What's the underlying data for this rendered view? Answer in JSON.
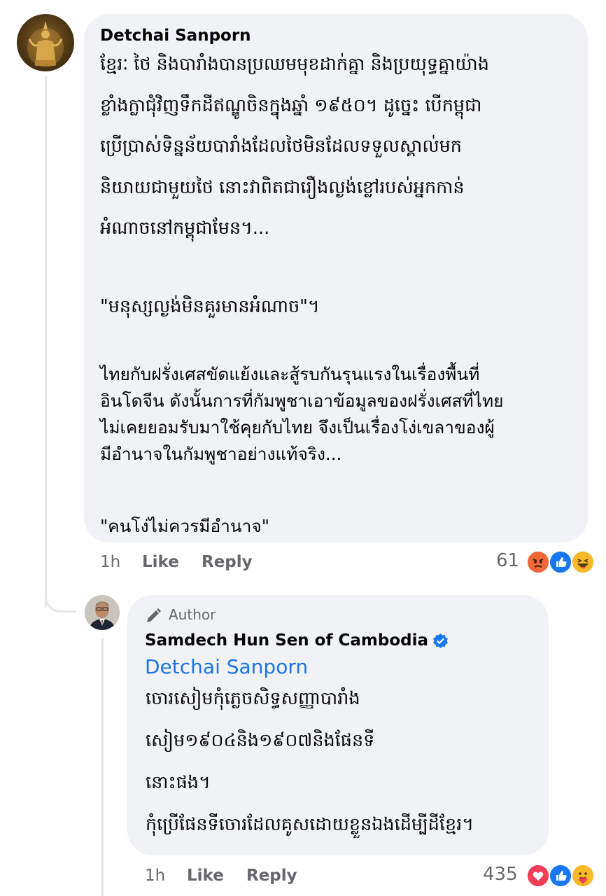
{
  "comment": {
    "author": "Detchai Sanporn",
    "khmer_lines": [
      "ខ្មែរៈ ថៃ និងបារាំងបានប្រឈមមុខដាក់គ្នា និងប្រយុទ្ធគ្នាយ៉ាង",
      "ខ្លាំងក្លាជុំវិញទឹកដីឥណ្ឌូចិនក្នុងឆ្នាំ ១៩៥០។ ដូច្នេះ បើកម្ពុជា",
      "ប្រើប្រាស់ទិន្នន័យបារាំងដែលថៃមិនដែលទទួលស្គាល់មក",
      "និយាយជាមួយថៃ នោះវាពិតជារឿងល្ងង់ខ្លៅរបស់អ្នកកាន់",
      "អំណាចនៅកម្ពុជាមែន។..."
    ],
    "khmer_quote": "\"មនុស្សល្ងង់មិនគួរមានអំណាច\"។",
    "thai_lines": [
      "ไทยกับฝรั่งเศสขัดแย้งและสู้รบกันรุนแรงในเรื่องพื้นที่",
      "อินโดจีน ดังนั้นการที่กัมพูชาเอาข้อมูลของฝรั่งเศสที่ไทย",
      "ไม่เคยยอมรับมาใช้คุยกับไทย จึงเป็นเรื่องโง่เขลาของผู้",
      "มีอำนาจในกัมพูชาอย่างแท้จริง..."
    ],
    "thai_quote": "\"คนโง่ไม่ควรมีอำนาจ\"",
    "time": "1h",
    "like_label": "Like",
    "reply_label": "Reply",
    "reaction_count": "61"
  },
  "reply": {
    "badge_label": "Author",
    "author": "Samdech Hun Sen of Cambodia",
    "mention": "Detchai Sanporn",
    "lines": [
      "ចោរសៀមកុំភ្លេចសិទ្ធសញ្ញាបារាំង",
      "សៀម១៩០៤និង១៩០៧និងផែនទី",
      "នោះផង។",
      "កុំប្រើផែនទីចោរដែលគូសដោយខ្លួនឯងដើម្បីដីខ្មែរ។"
    ],
    "time": "1h",
    "like_label": "Like",
    "reply_label": "Reply",
    "reaction_count": "435"
  },
  "colors": {
    "bubble": "#f0f2f5",
    "meta_text": "#65676b",
    "link": "#1b74e4",
    "verified": "#1877f2"
  },
  "icons": {
    "comment_reactions": [
      "angry-icon",
      "like-icon",
      "haha-icon"
    ],
    "reply_reactions": [
      "love-icon",
      "like-icon",
      "care-icon"
    ],
    "author_badge": "pencil-icon",
    "verified": "verified-badge-icon"
  }
}
